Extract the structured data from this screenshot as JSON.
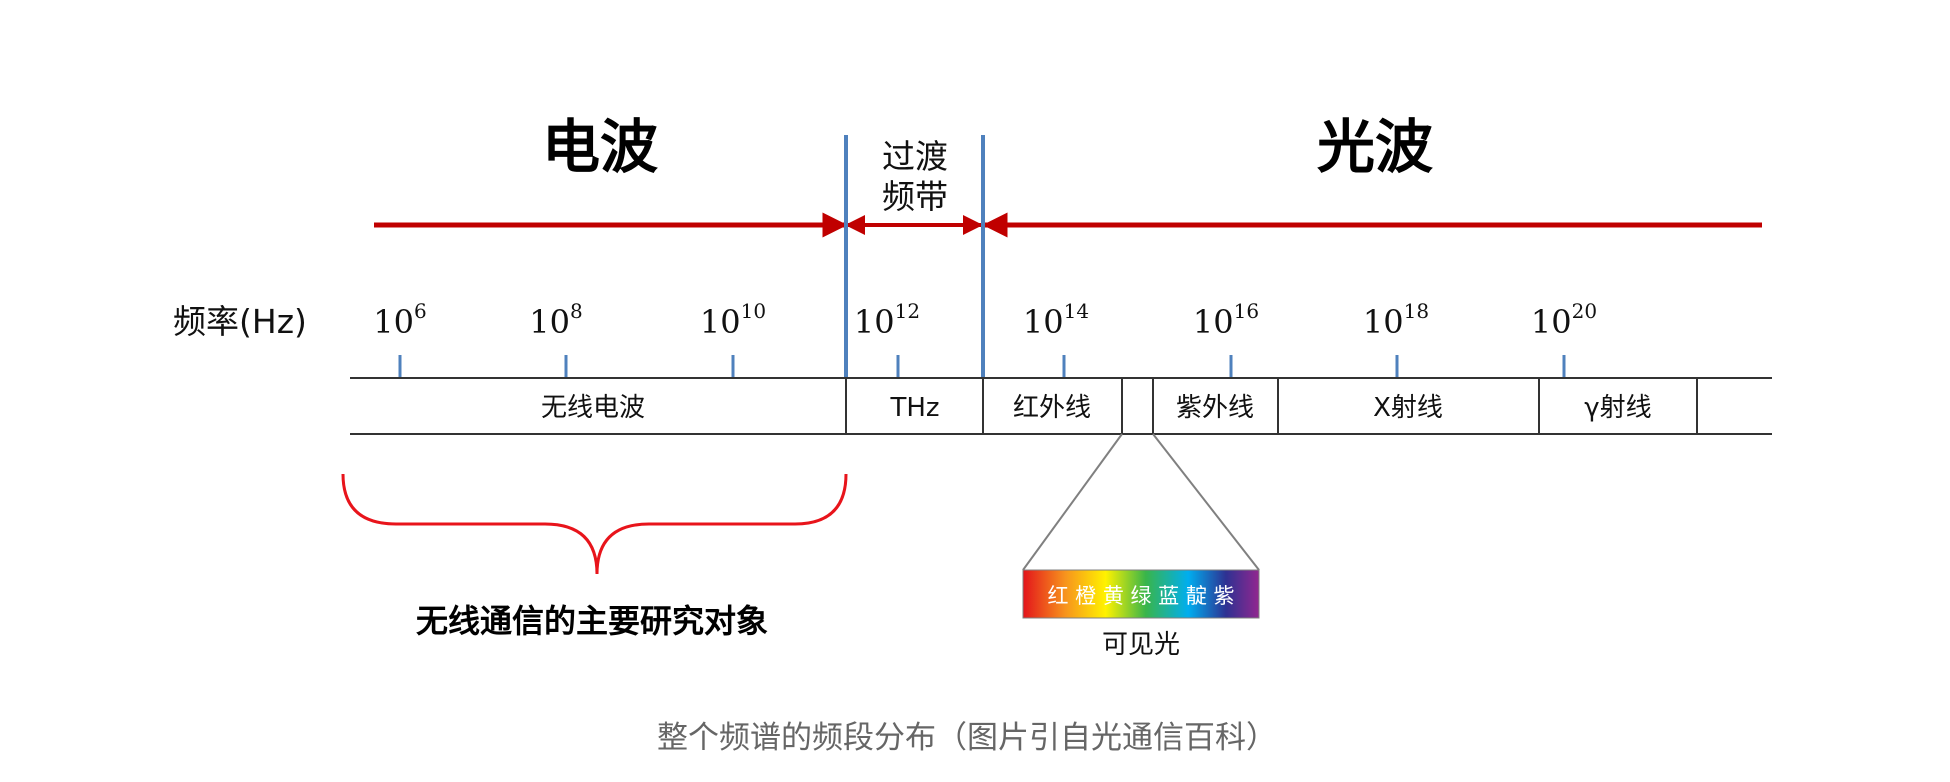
{
  "titles": {
    "radio_wave": "电波",
    "transition_line1": "过渡",
    "transition_line2": "频带",
    "light_wave": "光波"
  },
  "axis": {
    "label": "频率(Hz)",
    "tick_base": "10",
    "ticks": [
      {
        "exponent": "6"
      },
      {
        "exponent": "8"
      },
      {
        "exponent": "10"
      },
      {
        "exponent": "12"
      },
      {
        "exponent": "14"
      },
      {
        "exponent": "16"
      },
      {
        "exponent": "18"
      },
      {
        "exponent": "20"
      }
    ]
  },
  "bands": [
    {
      "label": "无线电波"
    },
    {
      "label": "THz"
    },
    {
      "label": "红外线"
    },
    {
      "label": ""
    },
    {
      "label": "紫外线"
    },
    {
      "label": "X射线"
    },
    {
      "label": "γ射线"
    },
    {
      "label": ""
    }
  ],
  "visible_light": {
    "colors_text": "红 橙 黄 绿 蓝 靛 紫",
    "label": "可见光"
  },
  "focus": {
    "label": "无线通信的主要研究对象"
  },
  "caption": "整个频谱的频段分布（图片引自光通信百科）",
  "colors": {
    "range_arrow": "#c00000",
    "boundary_line": "#4f81bd",
    "tick_mark": "#4f81bd",
    "brace": "#e8141b",
    "caption": "#666666"
  }
}
